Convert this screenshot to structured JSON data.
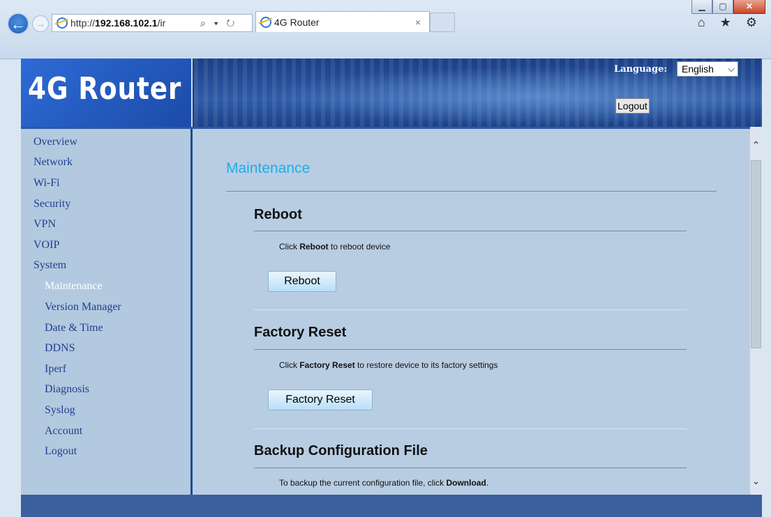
{
  "browser": {
    "url_prefix": "http://",
    "url_host": "192.168.102.1",
    "url_rest": "/ir",
    "address_tools": "⌕ ▾ ↻",
    "tab_title": "4G Router",
    "tab_close": "×",
    "right_icons": "⌂ ★ ⚙",
    "min_label": "▁",
    "max_label": "▢",
    "close_label": "✕",
    "back_glyph": "←",
    "forward_glyph": "→"
  },
  "header": {
    "logo": "4G Router",
    "language_label": "Language:",
    "language_value": "English",
    "logout": "Logout"
  },
  "sidebar": {
    "items": [
      {
        "label": "Overview"
      },
      {
        "label": "Network"
      },
      {
        "label": "Wi-Fi"
      },
      {
        "label": "Security"
      },
      {
        "label": "VPN"
      },
      {
        "label": "VOIP"
      },
      {
        "label": "System"
      }
    ],
    "sub_items": [
      {
        "label": "Maintenance",
        "active": true
      },
      {
        "label": "Version Manager"
      },
      {
        "label": "Date & Time"
      },
      {
        "label": "DDNS"
      },
      {
        "label": "Iperf"
      },
      {
        "label": "Diagnosis"
      },
      {
        "label": "Syslog"
      },
      {
        "label": "Account"
      },
      {
        "label": "Logout"
      }
    ]
  },
  "main": {
    "title": "Maintenance",
    "reboot": {
      "heading": "Reboot",
      "desc_pre": "Click ",
      "desc_bold": "Reboot",
      "desc_post": " to reboot device",
      "button": "Reboot"
    },
    "factory": {
      "heading": "Factory Reset",
      "desc_pre": "Click ",
      "desc_bold": "Factory Reset",
      "desc_post": " to restore device to its factory settings",
      "button": "Factory Reset"
    },
    "backup": {
      "heading": "Backup Configuration File",
      "desc_pre": "To backup the current configuration file, click ",
      "desc_bold": "Download",
      "desc_post": "."
    }
  },
  "colors": {
    "title": "#1eaee8",
    "nav_link": "#1f3f8f",
    "nav_active": "#ffffff",
    "banner": "#1a3f86"
  }
}
